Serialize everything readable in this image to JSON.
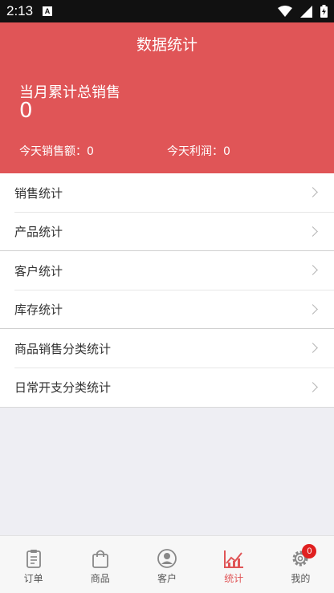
{
  "status_bar": {
    "time": "2:13",
    "notif": "A"
  },
  "header": {
    "title": "数据统计",
    "month_total_label": "当月累计总销售",
    "month_total_value": "0",
    "today_sales": "今天销售额：0",
    "today_profit": "今天利润：0"
  },
  "menu": {
    "items": [
      {
        "label": "销售统计"
      },
      {
        "label": "产品统计"
      },
      {
        "label": "客户统计"
      },
      {
        "label": "库存统计"
      },
      {
        "label": "商品销售分类统计"
      },
      {
        "label": "日常开支分类统计"
      }
    ]
  },
  "tabbar": {
    "tabs": [
      {
        "label": "订单",
        "icon": "clipboard-icon"
      },
      {
        "label": "商品",
        "icon": "shopping-bag-icon"
      },
      {
        "label": "客户",
        "icon": "user-icon"
      },
      {
        "label": "统计",
        "icon": "chart-icon",
        "active": true
      },
      {
        "label": "我的",
        "icon": "gear-icon",
        "badge": "0"
      }
    ]
  },
  "colors": {
    "accent": "#e05557",
    "badge": "#e02020"
  }
}
